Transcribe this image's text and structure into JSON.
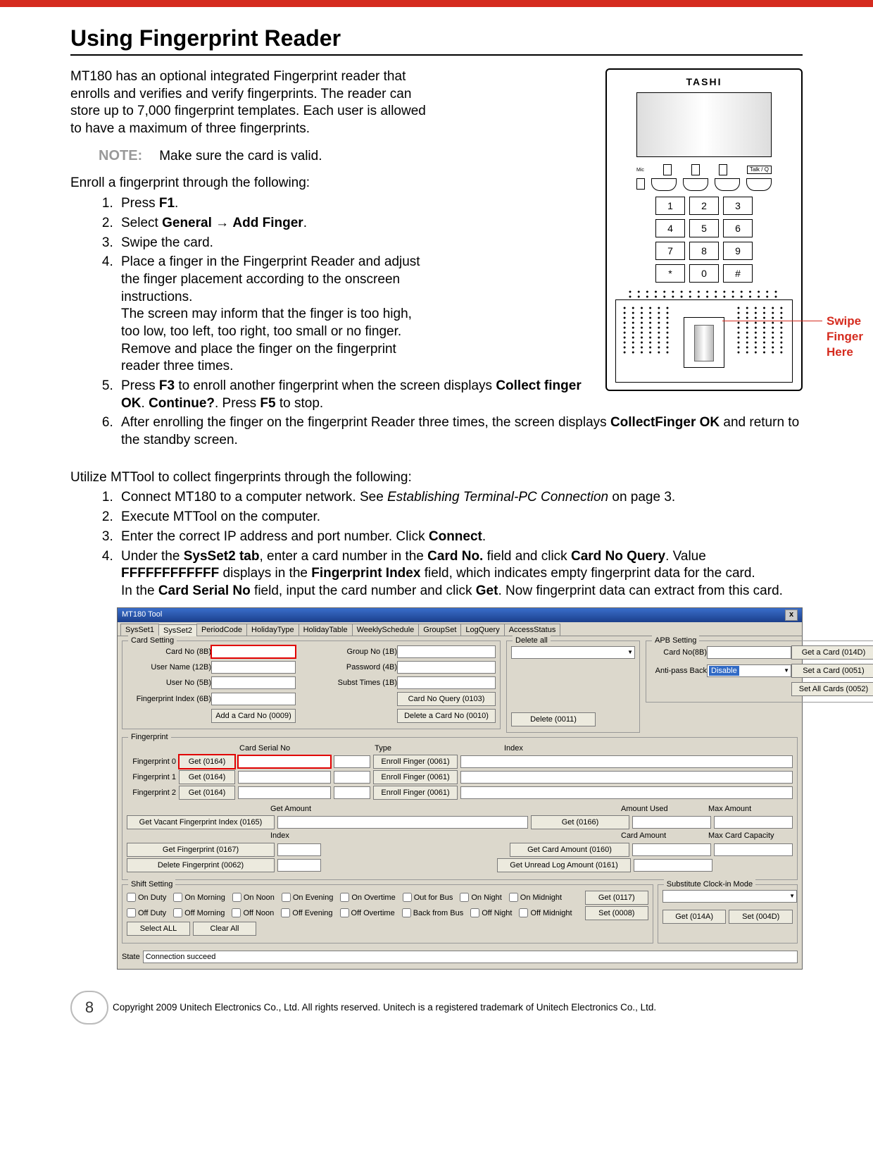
{
  "title": "Using Fingerprint Reader",
  "intro": "MT180 has an optional integrated Fingerprint reader that enrolls and verifies and verify fingerprints. The reader can store up to 7,000 fingerprint templates. Each user is allowed to have a maximum of three fingerprints.",
  "note_label": "NOTE:",
  "note_text": "Make sure the card is valid.",
  "enroll_lead": "Enroll a fingerprint through the following:",
  "steps1": {
    "s1_a": "Press ",
    "s1_b": "F1",
    "s1_c": ".",
    "s2_a": "Select ",
    "s2_b": "General",
    "s2_c": " → ",
    "s2_d": "Add Finger",
    "s2_e": ".",
    "s3": "Swipe the card.",
    "s4": "Place a finger in the Fingerprint Reader and adjust the finger placement according to the onscreen instructions.\nThe screen may inform that the finger is too high, too low, too left, too right, too small or no finger. Remove and place the finger on the fingerprint reader three times.",
    "s5_a": "Press ",
    "s5_b": "F3",
    "s5_c": " to enroll another fingerprint when the screen displays ",
    "s5_d": "Collect finger OK",
    "s5_e": ". ",
    "s5_f": "Continue?",
    "s5_g": ". Press ",
    "s5_h": "F5",
    "s5_i": " to stop.",
    "s6_a": "After enrolling the finger on the fingerprint Reader three times, the screen displays ",
    "s6_b": "CollectFinger OK",
    "s6_c": " and return to the standby screen."
  },
  "mttool_lead": "Utilize MTTool to collect fingerprints through the following:",
  "steps2": {
    "s1_a": "Connect MT180 to a computer network. See ",
    "s1_b": "Establishing Terminal-PC Connection",
    "s1_c": " on page 3.",
    "s2": "Execute MTTool on the computer.",
    "s3_a": "Enter the correct IP address and port number. Click ",
    "s3_b": "Connect",
    "s3_c": ".",
    "s4_a": "Under the ",
    "s4_b": "SysSet2 tab",
    "s4_c": ", enter a card number in the ",
    "s4_d": "Card No.",
    "s4_e": " field and click ",
    "s4_f": "Card No Query",
    "s4_g": ". Value ",
    "s4_h": "FFFFFFFFFFFF",
    "s4_i": " displays in the ",
    "s4_j": "Fingerprint Index",
    "s4_k": " field, which indicates empty fingerprint data for the card.\nIn the ",
    "s4_l": "Card Serial No",
    "s4_m": " field, input the card number and click ",
    "s4_n": "Get",
    "s4_o": ". Now fingerprint data can extract from this card."
  },
  "device": {
    "brand": "TASHI",
    "talk": "Talk / Q",
    "mic": "Mic",
    "keys": [
      "1",
      "2",
      "3",
      "4",
      "5",
      "6",
      "7",
      "8",
      "9",
      "*",
      "0",
      "#"
    ],
    "callout": "Swipe Finger Here"
  },
  "tool": {
    "title": "MT180 Tool",
    "close": "x",
    "tabs": [
      "SysSet1",
      "SysSet2",
      "PeriodCode",
      "HolidayType",
      "HolidayTable",
      "WeeklySchedule",
      "GroupSet",
      "LogQuery",
      "AccessStatus"
    ],
    "card_setting": {
      "legend": "Card Setting",
      "card_no": "Card No (8B)",
      "user_name": "User Name (12B)",
      "user_no": "User No (5B)",
      "fp_index": "Fingerprint Index (6B)",
      "group_no": "Group No (1B)",
      "password": "Password (4B)",
      "subst": "Subst Times (1B)",
      "card_no_query": "Card No Query (0103)",
      "add_card": "Add a Card No (0009)",
      "delete_card": "Delete a Card No (0010)"
    },
    "delete_all": "Delete all",
    "delete_btn": "Delete (0011)",
    "apb": {
      "legend": "APB Setting",
      "card_no": "Card No(8B)",
      "antipass": "Anti-pass Back",
      "antipass_val": "Disable",
      "get_card": "Get a Card (014D)",
      "set_card": "Set a Card (0051)",
      "set_all": "Set All Cards (0052)"
    },
    "fp": {
      "legend": "Fingerprint",
      "serial": "Card Serial No",
      "type": "Type",
      "index": "Index",
      "rows": [
        "Fingerprint 0",
        "Fingerprint 1",
        "Fingerprint 2"
      ],
      "get": "Get (0164)",
      "enroll": "Enroll Finger (0061)",
      "get_amount": "Get Amount",
      "vacant": "Get Vacant Fingerprint Index (0165)",
      "get_fp": "Get Fingerprint (0167)",
      "del_fp": "Delete Fingerprint (0062)",
      "idx": "Index",
      "get_0166": "Get (0166)",
      "get_card_amount": "Get Card Amount (0160)",
      "get_unread": "Get Unread Log Amount (0161)",
      "amount_used": "Amount Used",
      "max_amount": "Max Amount",
      "card_amount": "Card Amount",
      "max_card": "Max Card Capacity"
    },
    "shift": {
      "legend": "Shift Setting",
      "on": [
        "On Duty",
        "On Morning",
        "On Noon",
        "On Evening",
        "On Overtime",
        "Out for Bus",
        "On Night",
        "On Midnight"
      ],
      "off": [
        "Off Duty",
        "Off Morning",
        "Off Noon",
        "Off Evening",
        "Off Overtime",
        "Back from Bus",
        "Off Night",
        "Off Midnight"
      ],
      "get": "Get (0117)",
      "set": "Set (0008)",
      "select_all": "Select ALL",
      "clear_all": "Clear All"
    },
    "sub": {
      "legend": "Substitute Clock-in Mode",
      "get": "Get (014A)",
      "set": "Set (004D)"
    },
    "state_lbl": "State",
    "state_val": "Connection succeed"
  },
  "page_number": "8",
  "copyright": "Copyright 2009 Unitech Electronics Co., Ltd. All rights reserved. Unitech is a registered trademark of Unitech Electronics Co., Ltd."
}
